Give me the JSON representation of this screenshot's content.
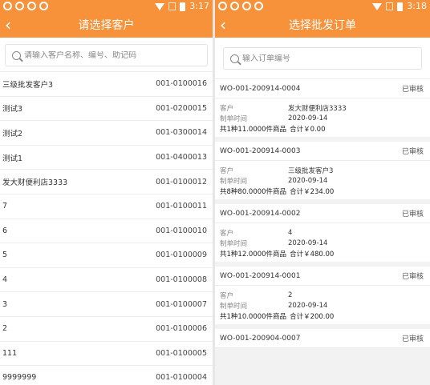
{
  "left": {
    "status_time": "3:17",
    "title": "请选择客户",
    "search_placeholder": "请输入客户名称、编号、助记码",
    "customers": [
      {
        "name": "三级批发客户3",
        "code": "001-0100016"
      },
      {
        "name": "测试3",
        "code": "001-0200015"
      },
      {
        "name": "测试2",
        "code": "001-0300014"
      },
      {
        "name": "测试1",
        "code": "001-0400013"
      },
      {
        "name": "发大财便利店3333",
        "code": "001-0100012"
      },
      {
        "name": "7",
        "code": "001-0100011"
      },
      {
        "name": "6",
        "code": "001-0100010"
      },
      {
        "name": "5",
        "code": "001-0100009"
      },
      {
        "name": "4",
        "code": "001-0100008"
      },
      {
        "name": "3",
        "code": "001-0100007"
      },
      {
        "name": "2",
        "code": "001-0100006"
      },
      {
        "name": "111",
        "code": "001-0100005"
      },
      {
        "name": "9999999",
        "code": "001-0100004"
      }
    ]
  },
  "right": {
    "status_time": "3:18",
    "title": "选择批发订单",
    "search_placeholder": "输入订单编号",
    "labels": {
      "customer": "客户",
      "date": "制单时间"
    },
    "orders": [
      {
        "no": "WO-001-200914-0004",
        "status": "已审核",
        "customer": "发大财便利店3333",
        "date": "2020-09-14",
        "qty": "共1种11.0000件商品",
        "total": "合计￥0.00"
      },
      {
        "no": "WO-001-200914-0003",
        "status": "已审核",
        "customer": "三级批发客户3",
        "date": "2020-09-14",
        "qty": "共8种80.0000件商品",
        "total": "合计￥234.00"
      },
      {
        "no": "WO-001-200914-0002",
        "status": "已审核",
        "customer": "4",
        "date": "2020-09-14",
        "qty": "共1种12.0000件商品",
        "total": "合计￥480.00"
      },
      {
        "no": "WO-001-200914-0001",
        "status": "已审核",
        "customer": "2",
        "date": "2020-09-14",
        "qty": "共1种10.0000件商品",
        "total": "合计￥200.00"
      },
      {
        "no": "WO-001-200904-0007",
        "status": "已审核"
      }
    ]
  },
  "colors": {
    "accent": "#f7923a"
  }
}
